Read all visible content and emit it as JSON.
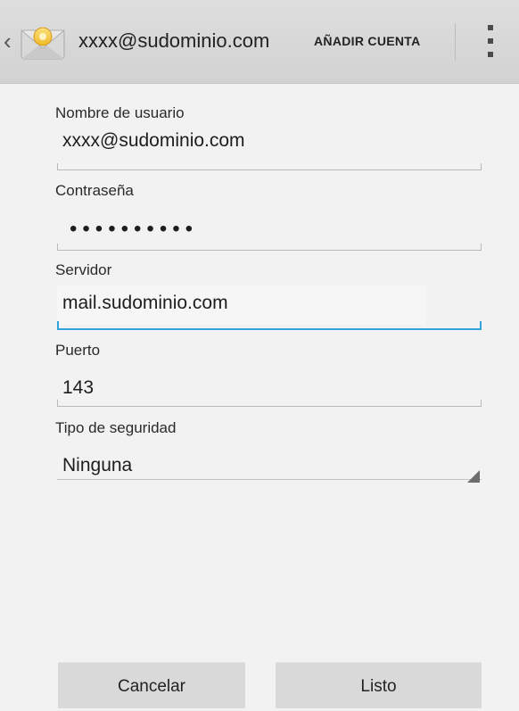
{
  "header": {
    "back_icon": "chevron-left-icon",
    "app_icon": "email-envelope-icon",
    "account_email": "xxxx@sudominio.com",
    "add_account_label": "AÑADIR CUENTA",
    "menu_icon": "overflow-menu-icon"
  },
  "form": {
    "username": {
      "label": "Nombre de usuario",
      "value": "xxxx@sudominio.com"
    },
    "password": {
      "label": "Contraseña",
      "value": "••••••••••"
    },
    "server": {
      "label": "Servidor",
      "value": "mail.sudominio.com"
    },
    "port": {
      "label": "Puerto",
      "value": "143"
    },
    "security": {
      "label": "Tipo de seguridad",
      "value": "Ninguna"
    }
  },
  "buttons": {
    "cancel": "Cancelar",
    "done": "Listo"
  },
  "colors": {
    "focus_accent": "#33a3dc",
    "envelope_yellow": "#f5c53a"
  }
}
